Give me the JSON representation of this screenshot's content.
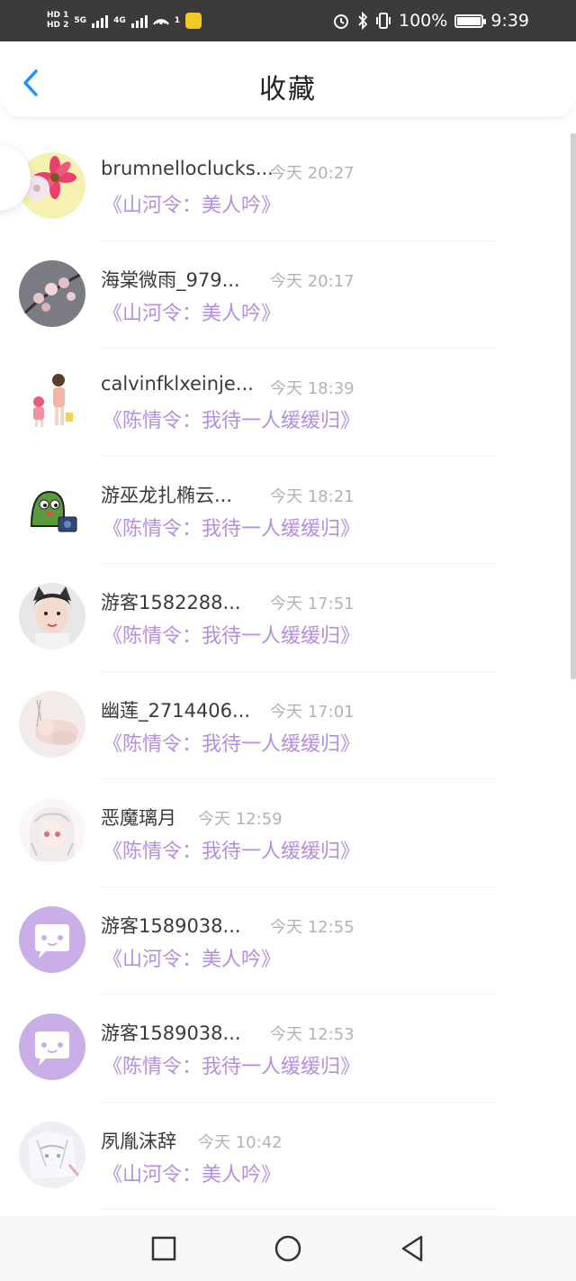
{
  "status_bar": {
    "hd1": "HD 1",
    "hd2": "HD 2",
    "net1": "5G",
    "net2": "4G",
    "wifi_label": "1",
    "battery": "100%",
    "time": "9:39"
  },
  "header": {
    "title": "收藏",
    "back_icon": "chevron-left-icon"
  },
  "favorites": [
    {
      "user": "brumnelloclucks...",
      "time": "今天 20:27",
      "work": "《山河令：美人吟》",
      "avatar": "pink-gerbera-flower"
    },
    {
      "user": "海棠微雨_979...",
      "time": "今天 20:17",
      "work": "《山河令：美人吟》",
      "avatar": "cherry-blossom-branch"
    },
    {
      "user": "calvinfklxeinje...",
      "time": "今天 18:39",
      "work": "《陈情令：我待一人缓缓归》",
      "avatar": "mother-and-child-drawing"
    },
    {
      "user": "游巫龙扎椭云...",
      "time": "今天 18:21",
      "work": "《陈情令：我待一人缓缓归》",
      "avatar": "green-bird-cartoon"
    },
    {
      "user": "游客1582288...",
      "time": "今天 17:51",
      "work": "《陈情令：我待一人缓缓归》",
      "avatar": "woman-cat-ears-photo"
    },
    {
      "user": "幽莲_2714406...",
      "time": "今天 17:01",
      "work": "《陈情令：我待一人缓缓归》",
      "avatar": "baby-photo"
    },
    {
      "user": "恶魔璃月",
      "time": "今天 12:59",
      "work": "《陈情令：我待一人缓缓归》",
      "avatar": "anime-girl-white-hair"
    },
    {
      "user": "游客1589038...",
      "time": "今天 12:55",
      "work": "《山河令：美人吟》",
      "avatar": "default-chat-avatar"
    },
    {
      "user": "游客1589038...",
      "time": "今天 12:53",
      "work": "《陈情令：我待一人缓缓归》",
      "avatar": "default-chat-avatar"
    },
    {
      "user": "夙胤沫辞",
      "time": "今天 10:42",
      "work": "《山河令：美人吟》",
      "avatar": "anime-sketch-face"
    }
  ],
  "navbar": {
    "recents_icon": "square-icon",
    "home_icon": "circle-icon",
    "back_icon": "triangle-back-icon"
  },
  "colors": {
    "accent_blue": "#1e90ff",
    "work_purple": "#b48ee0",
    "time_gray": "#b3b3b3",
    "default_avatar": "#c9aee8"
  }
}
